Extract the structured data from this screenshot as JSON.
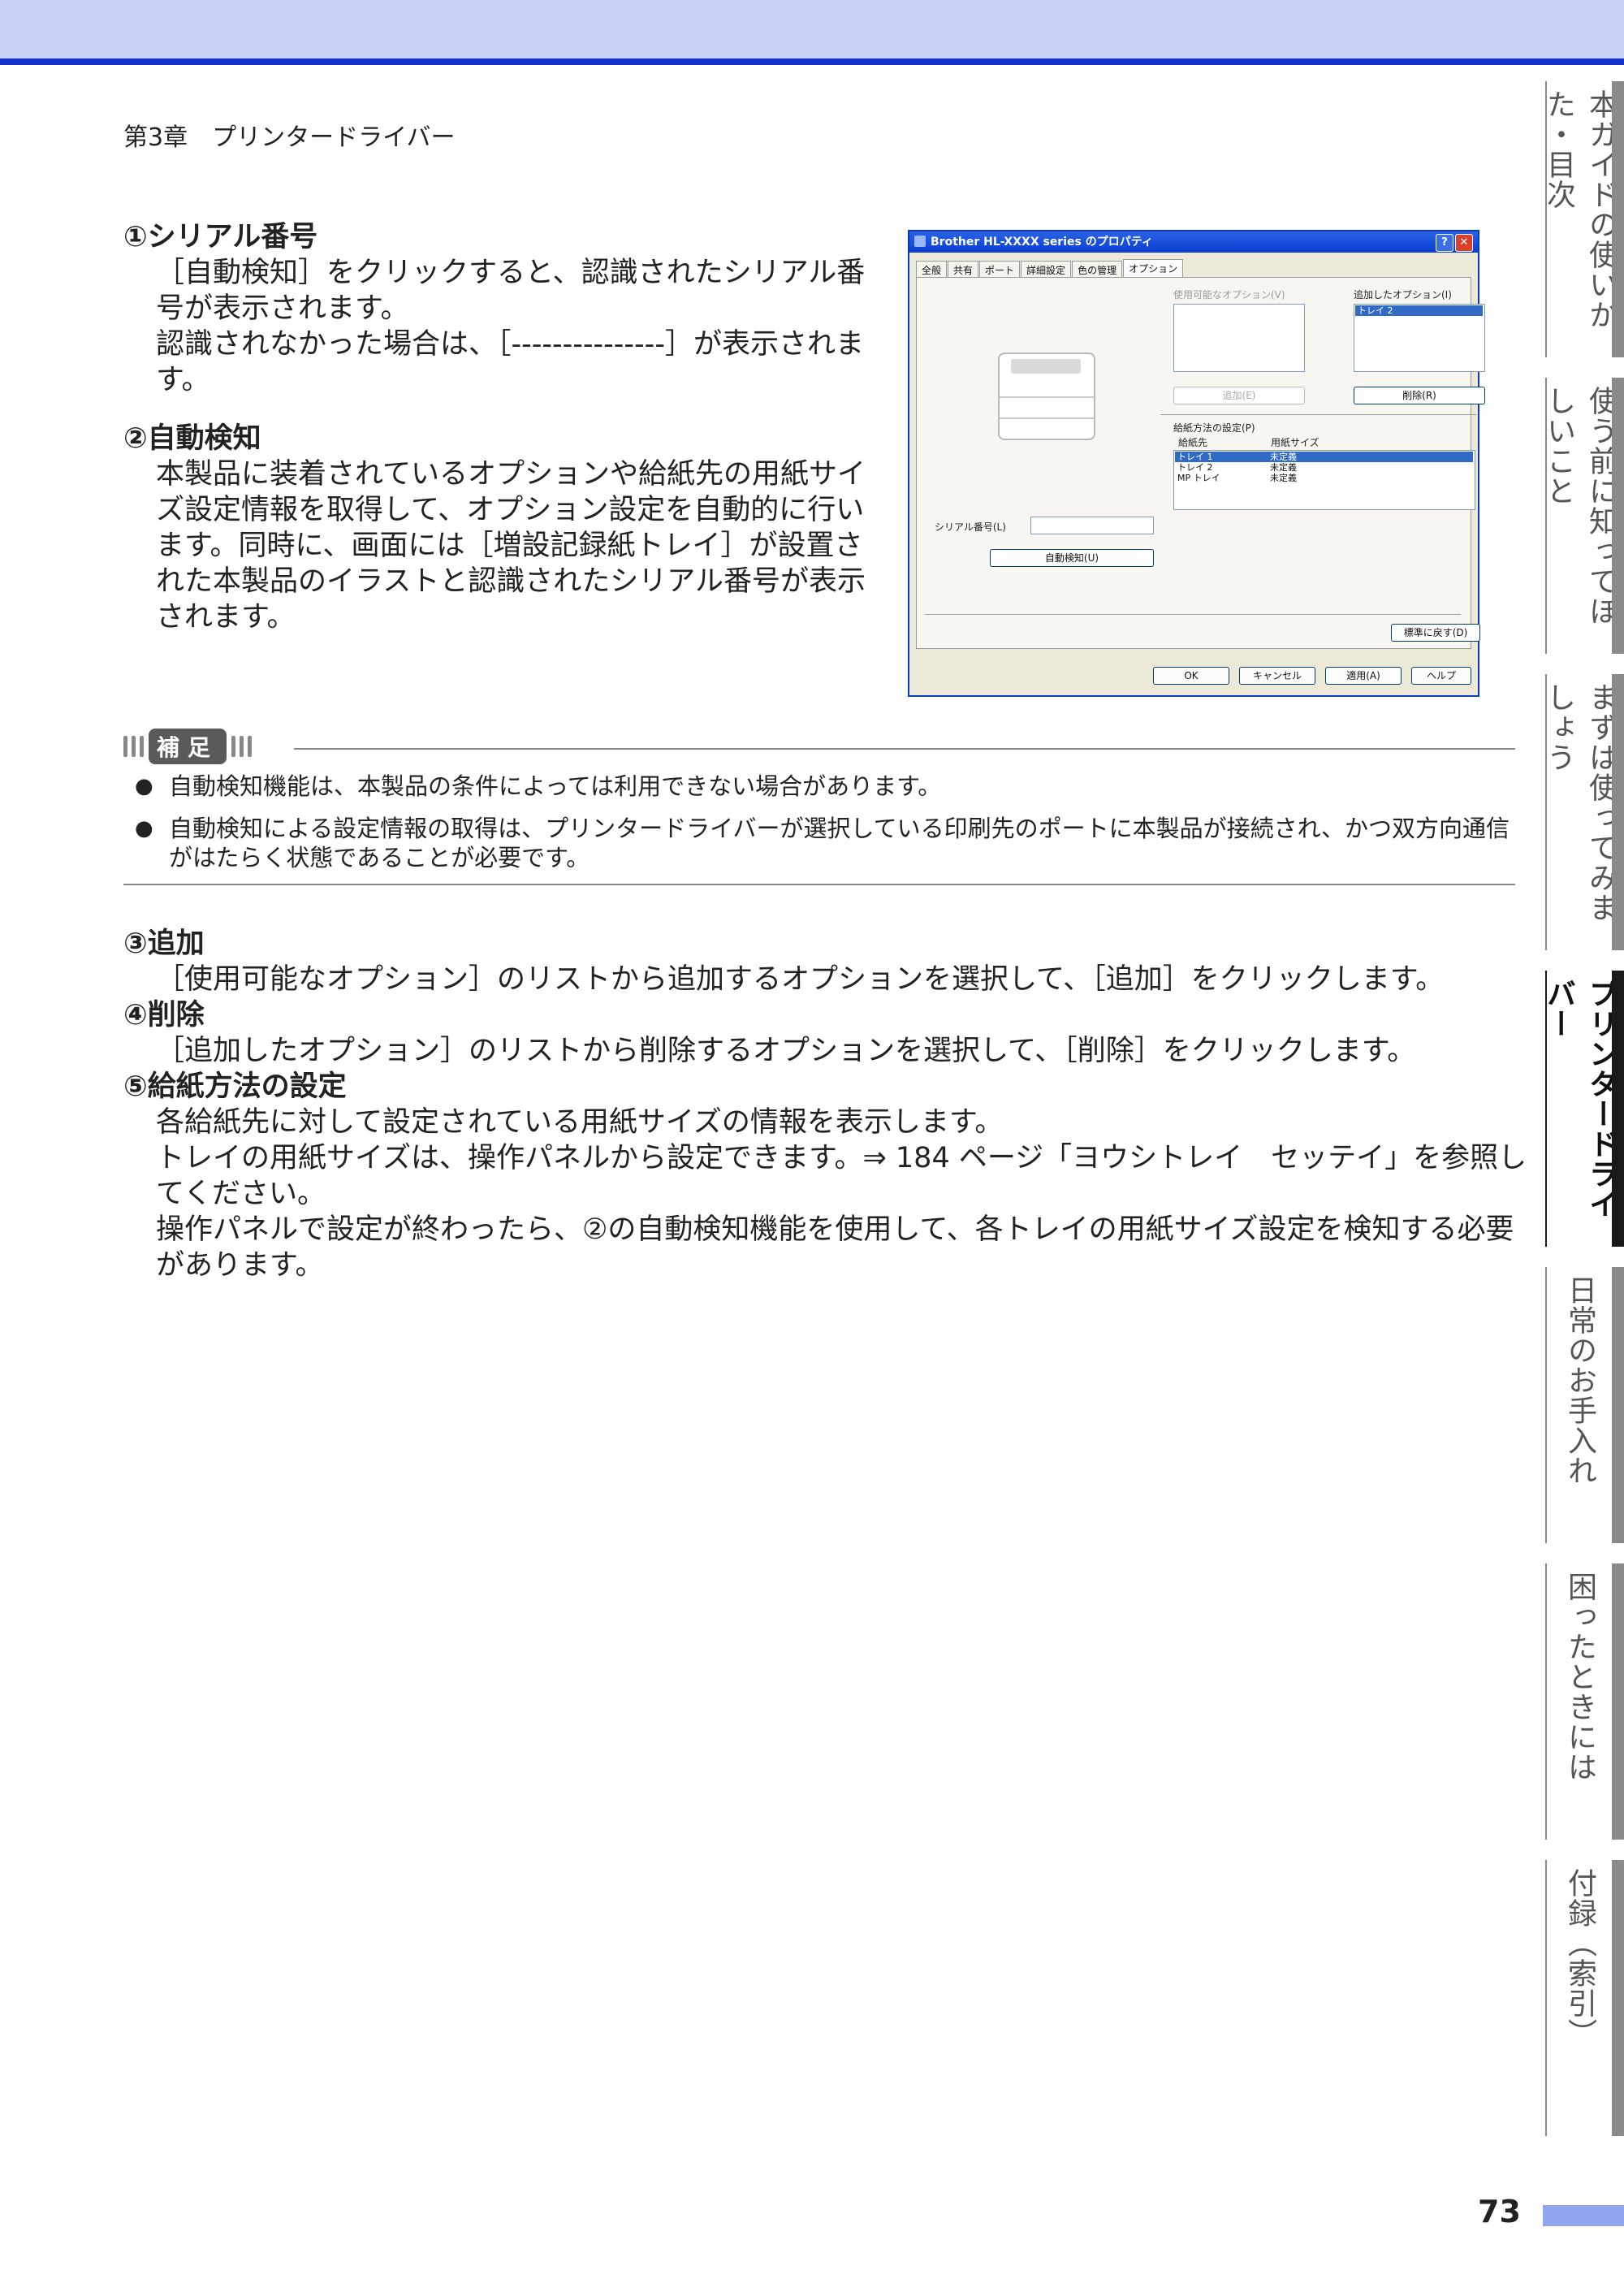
{
  "header": {
    "chapter": "第3章　プリンタードライバー"
  },
  "sections": {
    "s1": {
      "title": "①シリアル番号",
      "p1": "［自動検知］をクリックすると、認識されたシリアル番号が表示されます。",
      "p2": "認識されなかった場合は、［---------------］が表示されます。"
    },
    "s2": {
      "title": "②自動検知",
      "p1": "本製品に装着されているオプションや給紙先の用紙サイズ設定情報を取得して、オプション設定を自動的に行います。同時に、画面には［増設記録紙トレイ］が設置された本製品のイラストと認識されたシリアル番号が表示されます。"
    },
    "note": {
      "badge": "補足",
      "items": [
        "自動検知機能は、本製品の条件によっては利用できない場合があります。",
        "自動検知による設定情報の取得は、プリンタードライバーが選択している印刷先のポートに本製品が接続され、かつ双方向通信がはたらく状態であることが必要です。"
      ]
    },
    "s3": {
      "title": "③追加",
      "p1": "［使用可能なオプション］のリストから追加するオプションを選択して、［追加］をクリックします。"
    },
    "s4": {
      "title": "④削除",
      "p1": "［追加したオプション］のリストから削除するオプションを選択して、［削除］をクリックします。"
    },
    "s5": {
      "title": "⑤給紙方法の設定",
      "p1": "各給紙先に対して設定されている用紙サイズの情報を表示します。",
      "p2": "トレイの用紙サイズは、操作パネルから設定できます。⇒ 184 ページ「ヨウシトレイ　セッテイ」を参照してください。",
      "p3": "操作パネルで設定が終わったら、②の自動検知機能を使用して、各トレイの用紙サイズ設定を検知する必要があります。"
    }
  },
  "dialog": {
    "title": "Brother HL-XXXX series のプロパティ",
    "tabs": [
      "全般",
      "共有",
      "ポート",
      "詳細設定",
      "色の管理",
      "オプション"
    ],
    "available_label": "使用可能なオプション(V)",
    "added_label": "追加したオプション(I)",
    "added_items": [
      "トレイ 2"
    ],
    "add_button": "追加(E)",
    "delete_button": "削除(R)",
    "feed_group": "給紙方法の設定(P)",
    "col_source": "給紙先",
    "col_size": "用紙サイズ",
    "rows": [
      {
        "source": "トレイ 1",
        "size": "未定義"
      },
      {
        "source": "トレイ 2",
        "size": "未定義"
      },
      {
        "source": "MP トレイ",
        "size": "未定義"
      }
    ],
    "serial_label": "シリアル番号(L)",
    "autodetect_button": "自動検知(U)",
    "default_button": "標準に戻す(D)",
    "ok": "OK",
    "cancel": "キャンセル",
    "apply": "適用(A)",
    "help": "ヘルプ"
  },
  "side_tabs": [
    "本ガイドの使いかた・目次",
    "使う前に知ってほしいこと",
    "まずは使ってみましょう",
    "プリンタードライバー",
    "日常のお手入れ",
    "困ったときには",
    "付録（索引）"
  ],
  "active_tab_index": 3,
  "page_number": "73",
  "colors": {
    "top_band": "#c9d3f7",
    "top_rule": "#1433cc",
    "page_tab": "#8fa6ee"
  }
}
